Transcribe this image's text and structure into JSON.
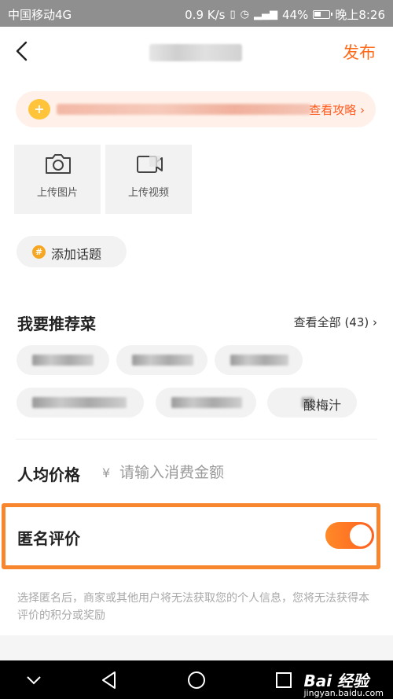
{
  "status_bar": {
    "carrier": "中国移动4G",
    "speed": "0.9 K/s",
    "battery": "44%",
    "time": "晚上8:26"
  },
  "header": {
    "publish_label": "发布"
  },
  "tip": {
    "link_label": "查看攻略 ›"
  },
  "uploads": {
    "photo_label": "上传图片",
    "video_label": "上传视频"
  },
  "topic": {
    "label": "添加话题"
  },
  "recommend": {
    "title": "我要推荐菜",
    "view_all": "查看全部 (43) ›",
    "dishes": [
      {
        "label": ""
      },
      {
        "label": ""
      },
      {
        "label": ""
      },
      {
        "label": ""
      },
      {
        "label": ""
      },
      {
        "label": "酸梅汁"
      }
    ]
  },
  "price": {
    "label": "人均价格",
    "currency": "¥",
    "placeholder": "请输入消费金额"
  },
  "anonymous": {
    "label": "匿名评价",
    "enabled": true,
    "note": "选择匿名后，商家或其他用户将无法获取您的个人信息，您将无法获得本评价的积分或奖励"
  },
  "watermark": {
    "brand": "Bai 经验",
    "site": "jingyan.baidu.com"
  },
  "colors": {
    "accent": "#ff6a1a",
    "highlight_border": "#f7862f",
    "chip_bg": "#f2f2f2"
  }
}
